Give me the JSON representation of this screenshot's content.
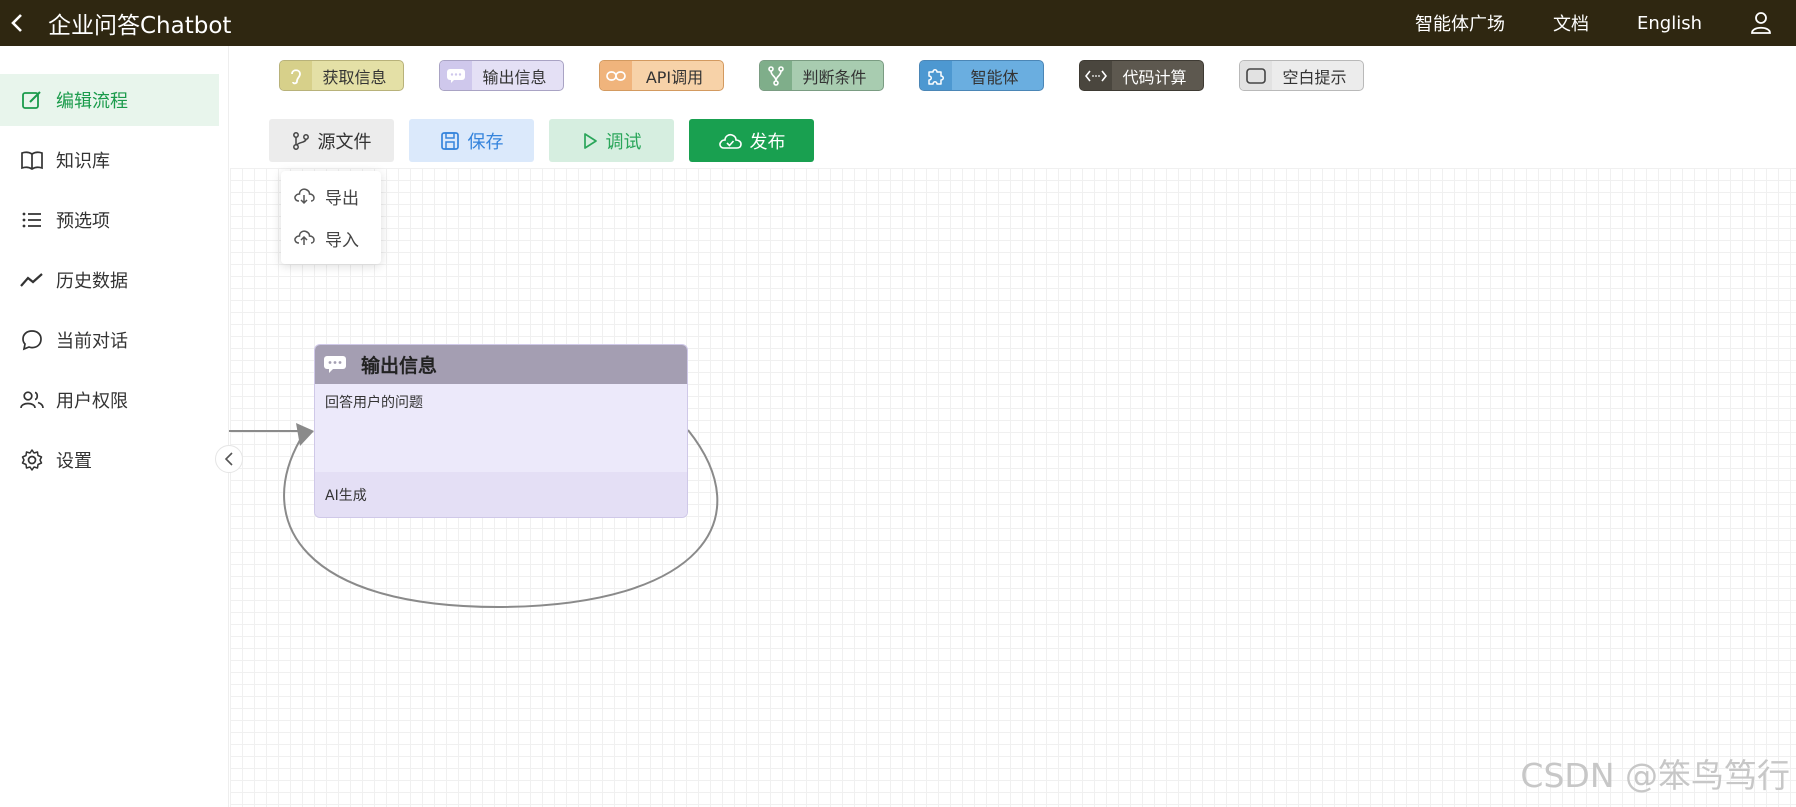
{
  "header": {
    "title": "企业问答Chatbot",
    "links": [
      "智能体广场",
      "文档",
      "English"
    ]
  },
  "sidebar": {
    "items": [
      {
        "label": "编辑流程",
        "icon": "edit-icon",
        "active": true
      },
      {
        "label": "知识库",
        "icon": "book-icon"
      },
      {
        "label": "预选项",
        "icon": "list-icon"
      },
      {
        "label": "历史数据",
        "icon": "trend-icon"
      },
      {
        "label": "当前对话",
        "icon": "chat-icon"
      },
      {
        "label": "用户权限",
        "icon": "users-icon"
      },
      {
        "label": "设置",
        "icon": "gear-icon"
      }
    ]
  },
  "palette": [
    {
      "label": "获取信息",
      "icon": "ear-icon",
      "bg": "#e4e0a6",
      "iconBg": "#d7d08a",
      "border": "#b8b27a"
    },
    {
      "label": "输出信息",
      "icon": "message-icon",
      "bg": "#e4e0f5",
      "iconBg": "#cfc8ec",
      "border": "#a9a3c4"
    },
    {
      "label": "API调用",
      "icon": "link-icon",
      "bg": "#f7d2a8",
      "iconBg": "#f0b47c",
      "border": "#d39a60"
    },
    {
      "label": "判断条件",
      "icon": "branch-icon",
      "bg": "#a8ccb0",
      "iconBg": "#7fae8a",
      "border": "#7a9c82"
    },
    {
      "label": "智能体",
      "icon": "puzzle-icon",
      "bg": "#6aaee0",
      "iconBg": "#4d98d1",
      "border": "#4b86b6"
    },
    {
      "label": "代码计算",
      "icon": "code-icon",
      "bg": "#5d584f",
      "iconBg": "#4a463e",
      "border": "#3e3a33",
      "fg": "#ffffff"
    },
    {
      "label": "空白提示",
      "icon": "square-icon",
      "bg": "#ececec",
      "iconBg": "#e2e2e2",
      "border": "#b9b9b9"
    }
  ],
  "toolbar": {
    "source_label": "源文件",
    "save_label": "保存",
    "debug_label": "调试",
    "publish_label": "发布"
  },
  "dropdown": {
    "export_label": "导出",
    "import_label": "导入"
  },
  "node": {
    "title": "输出信息",
    "description": "回答用户的问题",
    "footer": "AI生成"
  },
  "watermark": "CSDN @笨鸟笃行"
}
